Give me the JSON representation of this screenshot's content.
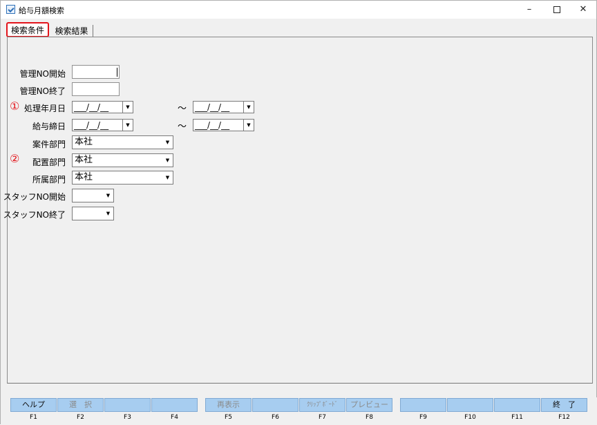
{
  "window": {
    "title": "給与月額検索",
    "minimize": "–",
    "close": "✕"
  },
  "tabs": [
    {
      "label": "検索条件",
      "active": true
    },
    {
      "label": "検索結果",
      "active": false
    }
  ],
  "form": {
    "kanri_no_start": {
      "label": "管理NO開始",
      "value": ""
    },
    "kanri_no_end": {
      "label": "管理NO終了",
      "value": ""
    },
    "marker1": "①",
    "marker2": "②",
    "shori_date": {
      "label": "処理年月日",
      "from": "___/__/__",
      "to": "___/__/__"
    },
    "kyuyo_shime": {
      "label": "給与締日",
      "from": "___/__/__",
      "to": "___/__/__"
    },
    "tilde": "～",
    "anken_bumon": {
      "label": "案件部門",
      "value": "本社"
    },
    "haichi_bumon": {
      "label": "配置部門",
      "value": "本社"
    },
    "shozoku_bumon": {
      "label": "所属部門",
      "value": "本社"
    },
    "staff_no_start": {
      "label": "スタッフNO開始",
      "value": ""
    },
    "staff_no_end": {
      "label": "スタッフNO終了",
      "value": ""
    }
  },
  "function_keys": [
    {
      "key": "F1",
      "label": "ヘルプ",
      "enabled": true
    },
    {
      "key": "F2",
      "label": "選　択",
      "enabled": false
    },
    {
      "key": "F3",
      "label": "",
      "enabled": false
    },
    {
      "key": "F4",
      "label": "",
      "enabled": false
    },
    {
      "key": "F5",
      "label": "再表示",
      "enabled": false
    },
    {
      "key": "F6",
      "label": "",
      "enabled": false
    },
    {
      "key": "F7",
      "label": "ｸﾘｯﾌﾟﾎﾞｰﾄﾞ",
      "enabled": false
    },
    {
      "key": "F8",
      "label": "プレビュー",
      "enabled": false
    },
    {
      "key": "F9",
      "label": "",
      "enabled": false
    },
    {
      "key": "F10",
      "label": "",
      "enabled": false
    },
    {
      "key": "F11",
      "label": "",
      "enabled": false
    },
    {
      "key": "F12",
      "label": "終　了",
      "enabled": true
    }
  ],
  "colors": {
    "accent_red": "#e3141b",
    "fkey_blue": "#a7cdf0"
  }
}
